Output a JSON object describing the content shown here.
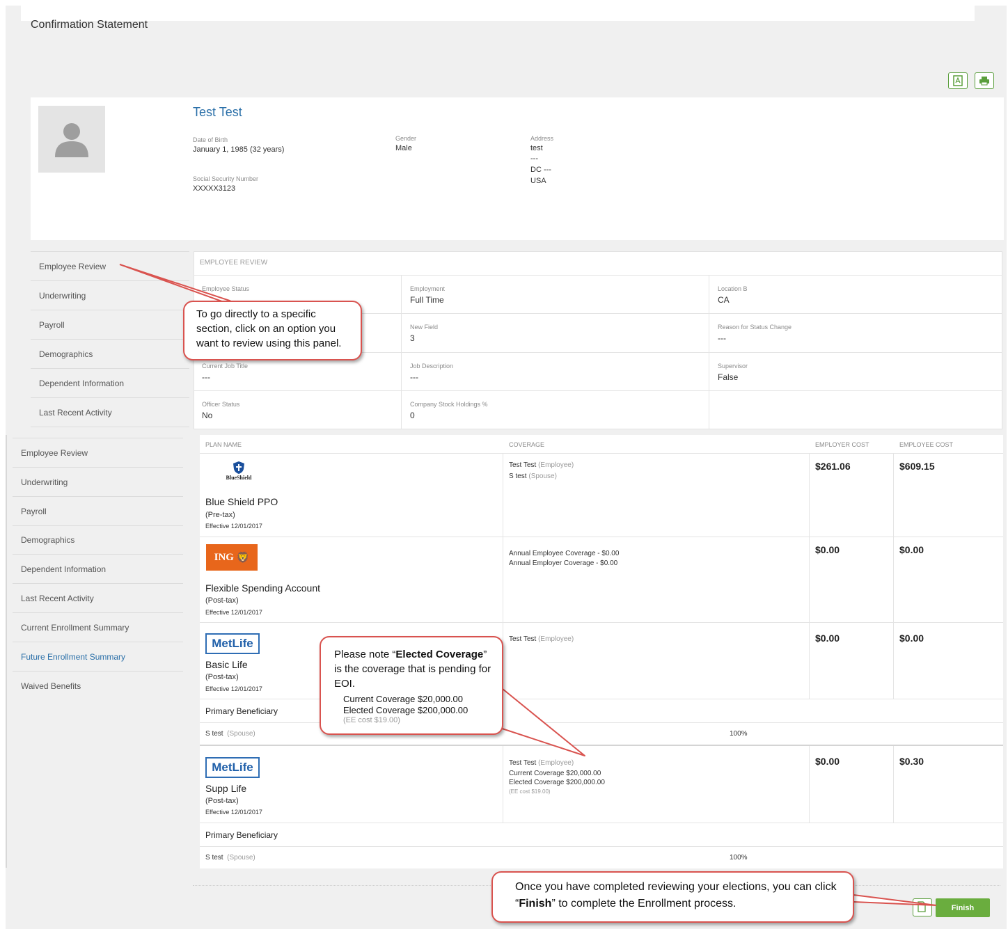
{
  "page": {
    "title": "Confirmation Statement"
  },
  "profile": {
    "name": "Test Test",
    "dob_label": "Date of Birth",
    "dob": "January 1, 1985 (32 years)",
    "gender_label": "Gender",
    "gender": "Male",
    "address_label": "Address",
    "address_lines": [
      "test",
      "---",
      "DC  ---",
      "USA"
    ],
    "ssn_label": "Social Security Number",
    "ssn": "XXXXX3123"
  },
  "nav_primary": [
    "Employee Review",
    "Underwriting",
    "Payroll",
    "Demographics",
    "Dependent Information",
    "Last Recent Activity"
  ],
  "nav_secondary": [
    "Employee Review",
    "Underwriting",
    "Payroll",
    "Demographics",
    "Dependent Information",
    "Last Recent Activity",
    "Current Enrollment Summary",
    "Future Enrollment Summary",
    "Waived Benefits"
  ],
  "nav_active_secondary": "Future Enrollment Summary",
  "employee_review": {
    "heading": "EMPLOYEE REVIEW",
    "rows": [
      [
        {
          "label": "Employee Status",
          "value": ""
        },
        {
          "label": "Employment",
          "value": "Full Time"
        },
        {
          "label": "Location B",
          "value": "CA"
        }
      ],
      [
        {
          "label": "",
          "value": ""
        },
        {
          "label": "New Field",
          "value": "3"
        },
        {
          "label": "Reason for Status Change",
          "value": "---"
        }
      ],
      [
        {
          "label": "Current Job Title",
          "value": "---"
        },
        {
          "label": "Job Description",
          "value": "---"
        },
        {
          "label": "Supervisor",
          "value": "False"
        }
      ],
      [
        {
          "label": "Officer Status",
          "value": "No"
        },
        {
          "label": "Company Stock Holdings %",
          "value": "0"
        },
        {
          "label": "",
          "value": ""
        }
      ]
    ]
  },
  "plans_table": {
    "headers": [
      "PLAN NAME",
      "COVERAGE",
      "EMPLOYER COST",
      "EMPLOYEE COST"
    ],
    "plans": [
      {
        "logo": "BlueShield",
        "name": "Blue Shield PPO",
        "tax": "(Pre-tax)",
        "effective": "Effective  12/01/2017",
        "coverage": [
          {
            "name": "Test Test",
            "role": "(Employee)"
          },
          {
            "name": "S test",
            "role": "(Spouse)"
          }
        ],
        "employer_cost": "$261.06",
        "employee_cost": "$609.15"
      },
      {
        "logo": "ING",
        "name": "Flexible Spending Account",
        "tax": "(Post-tax)",
        "effective": "Effective  12/01/2017",
        "coverage_lines": [
          "Annual Employee Coverage - $0.00",
          "Annual Employer Coverage - $0.00"
        ],
        "employer_cost": "$0.00",
        "employee_cost": "$0.00"
      },
      {
        "logo": "MetLife",
        "name": "Basic Life",
        "tax": "(Post-tax)",
        "effective": "Effective  12/01/2017",
        "coverage": [
          {
            "name": "Test Test",
            "role": "(Employee)"
          }
        ],
        "employer_cost": "$0.00",
        "employee_cost": "$0.00",
        "beneficiary_heading": "Primary Beneficiary",
        "beneficiary": {
          "name": "S test",
          "role": "(Spouse)",
          "percent": "100%"
        }
      },
      {
        "logo": "MetLife",
        "name": "Supp Life",
        "tax": "(Post-tax)",
        "effective": "Effective  12/01/2017",
        "coverage": [
          {
            "name": "Test Test",
            "role": "(Employee)"
          }
        ],
        "coverage_lines": [
          "Current Coverage  $20,000.00",
          "Elected Coverage  $200,000.00"
        ],
        "coverage_note": "(EE cost $19.00)",
        "employer_cost": "$0.00",
        "employee_cost": "$0.30",
        "beneficiary_heading": "Primary Beneficiary",
        "beneficiary": {
          "name": "S test",
          "role": "(Spouse)",
          "percent": "100%"
        }
      }
    ]
  },
  "callouts": {
    "nav_tip": "To go directly to a specific section, click on an option you want to review using this panel.",
    "eoi_tip_prefix": "Please note “",
    "eoi_tip_bold": "Elected Coverage",
    "eoi_tip_suffix": "” is the coverage that is pending for EOI.",
    "eoi_current": "Current Coverage  $20,000.00",
    "eoi_elected": "Elected Coverage  $200,000.00",
    "eoi_note": "(EE cost $19.00)",
    "finish_tip_prefix": "Once you have completed reviewing your elections, you can click “",
    "finish_tip_bold": "Finish",
    "finish_tip_suffix": "” to complete the Enrollment process."
  },
  "logos": {
    "blueshield_text": "BlueShield",
    "ing_text": "ING",
    "metlife_text": "MetLife"
  },
  "actions": {
    "finish_label": "Finish"
  },
  "icons": {
    "pdf": "pdf-icon",
    "print": "printer-icon",
    "save": "document-icon",
    "avatar": "user-silhouette-icon"
  },
  "colors": {
    "accent_blue": "#2a6fa8",
    "green": "#6aad3e",
    "callout_border": "#d9534f",
    "ing_orange": "#e8661b",
    "metlife_blue": "#1f5fa9"
  }
}
